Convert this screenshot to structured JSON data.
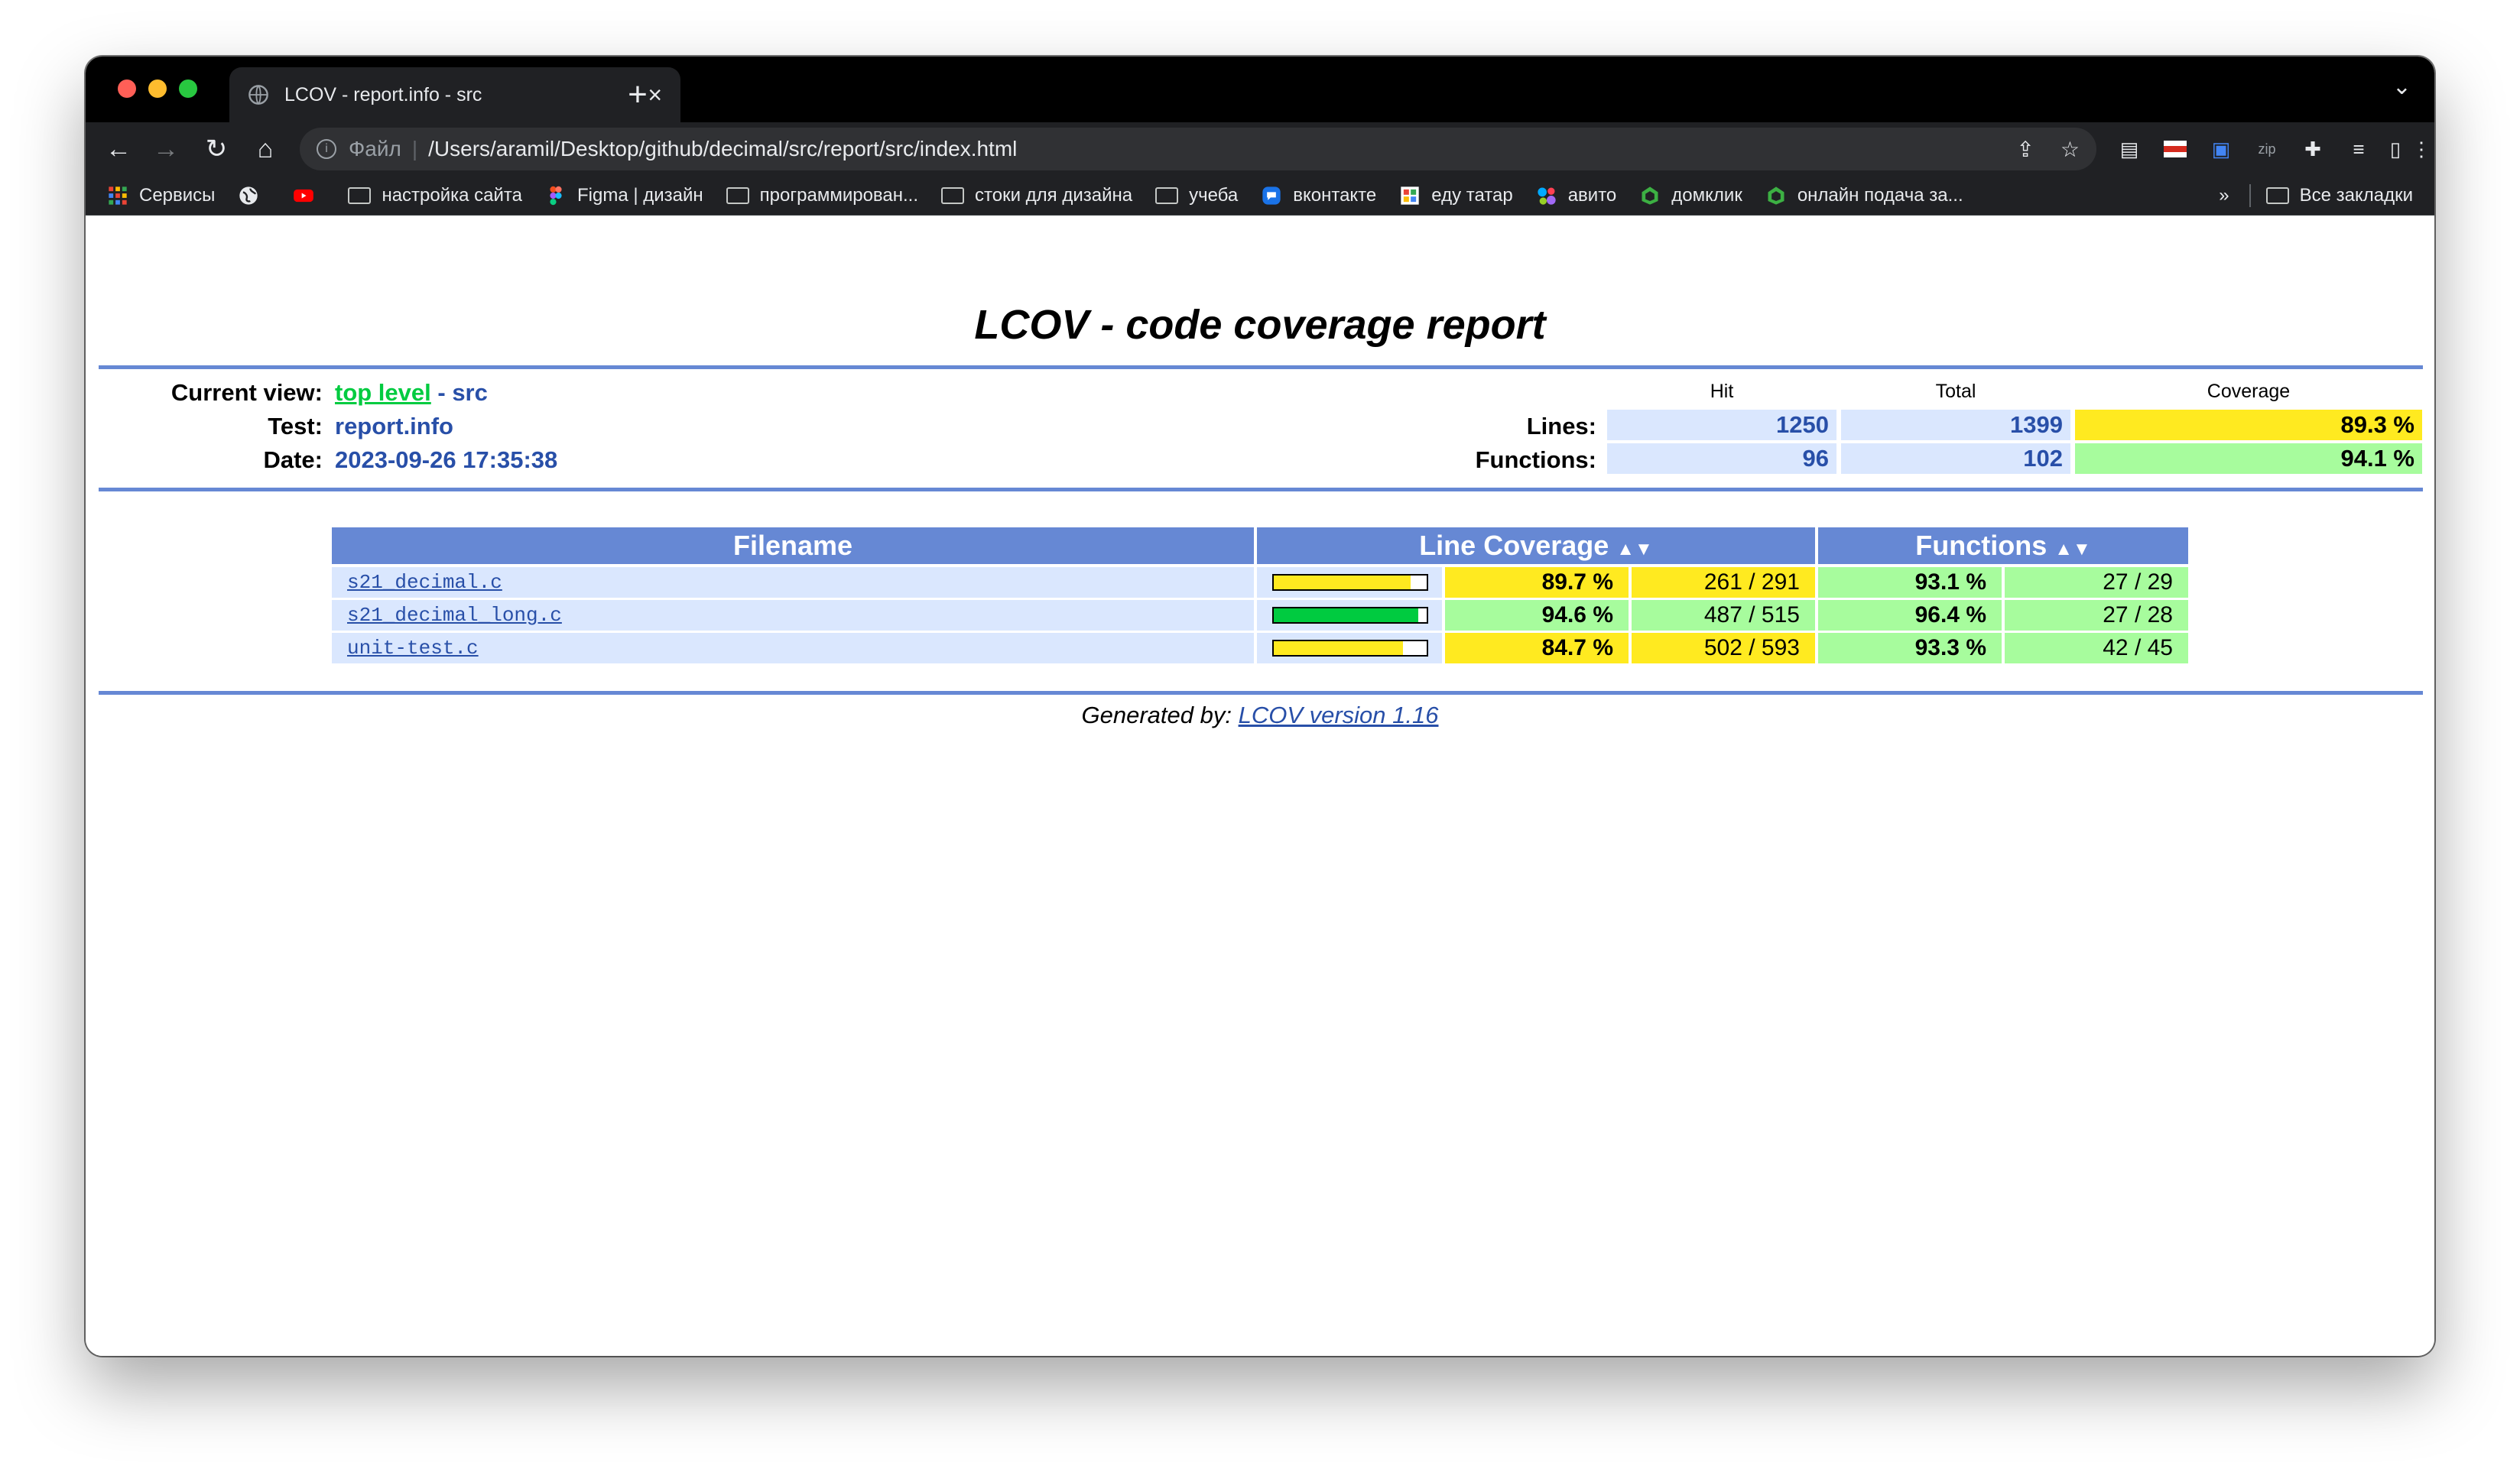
{
  "browser": {
    "tab_title": "LCOV - report.info - src",
    "address_scheme": "Файл",
    "address_url": "/Users/aramil/Desktop/github/decimal/src/report/src/index.html",
    "bookmarks": [
      "Сервисы",
      "настройка сайта",
      "Figma | дизайн",
      "программирован...",
      "стоки для дизайна",
      "учеба",
      "вконтакте",
      "еду татар",
      "авито",
      "домклик",
      "онлайн подача за..."
    ],
    "bookmarks_overflow": "»",
    "all_bookmarks": "Все закладки"
  },
  "report": {
    "title": "LCOV - code coverage report",
    "current_view_label": "Current view:",
    "current_view_link": "top level",
    "current_view_rest": " - src",
    "test_label": "Test:",
    "test_value": "report.info",
    "date_label": "Date:",
    "date_value": "2023-09-26 17:35:38",
    "summary_headers": {
      "hit": "Hit",
      "total": "Total",
      "coverage": "Coverage"
    },
    "lines": {
      "label": "Lines:",
      "hit": "1250",
      "total": "1399",
      "coverage": "89.3 %"
    },
    "functions": {
      "label": "Functions:",
      "hit": "96",
      "total": "102",
      "coverage": "94.1 %"
    },
    "table_headers": {
      "filename": "Filename",
      "line_coverage": "Line Coverage",
      "functions": "Functions"
    },
    "files": [
      {
        "name": "s21_decimal.c",
        "line_pct": "89.7 %",
        "lines": "261 / 291",
        "func_pct": "93.1 %",
        "funcs": "27 / 29",
        "bar_fraction": 0.897,
        "bar_color": "#ffea20"
      },
      {
        "name": "s21_decimal_long.c",
        "line_pct": "94.6 %",
        "lines": "487 / 515",
        "func_pct": "96.4 %",
        "funcs": "27 / 28",
        "bar_fraction": 0.946,
        "bar_color": "#00cb40"
      },
      {
        "name": "unit-test.c",
        "line_pct": "84.7 %",
        "lines": "502 / 593",
        "func_pct": "93.3 %",
        "funcs": "42 / 45",
        "bar_fraction": 0.847,
        "bar_color": "#ffea20"
      }
    ],
    "generated_by_label": "Generated by: ",
    "generated_by_link": "LCOV version 1.16"
  }
}
